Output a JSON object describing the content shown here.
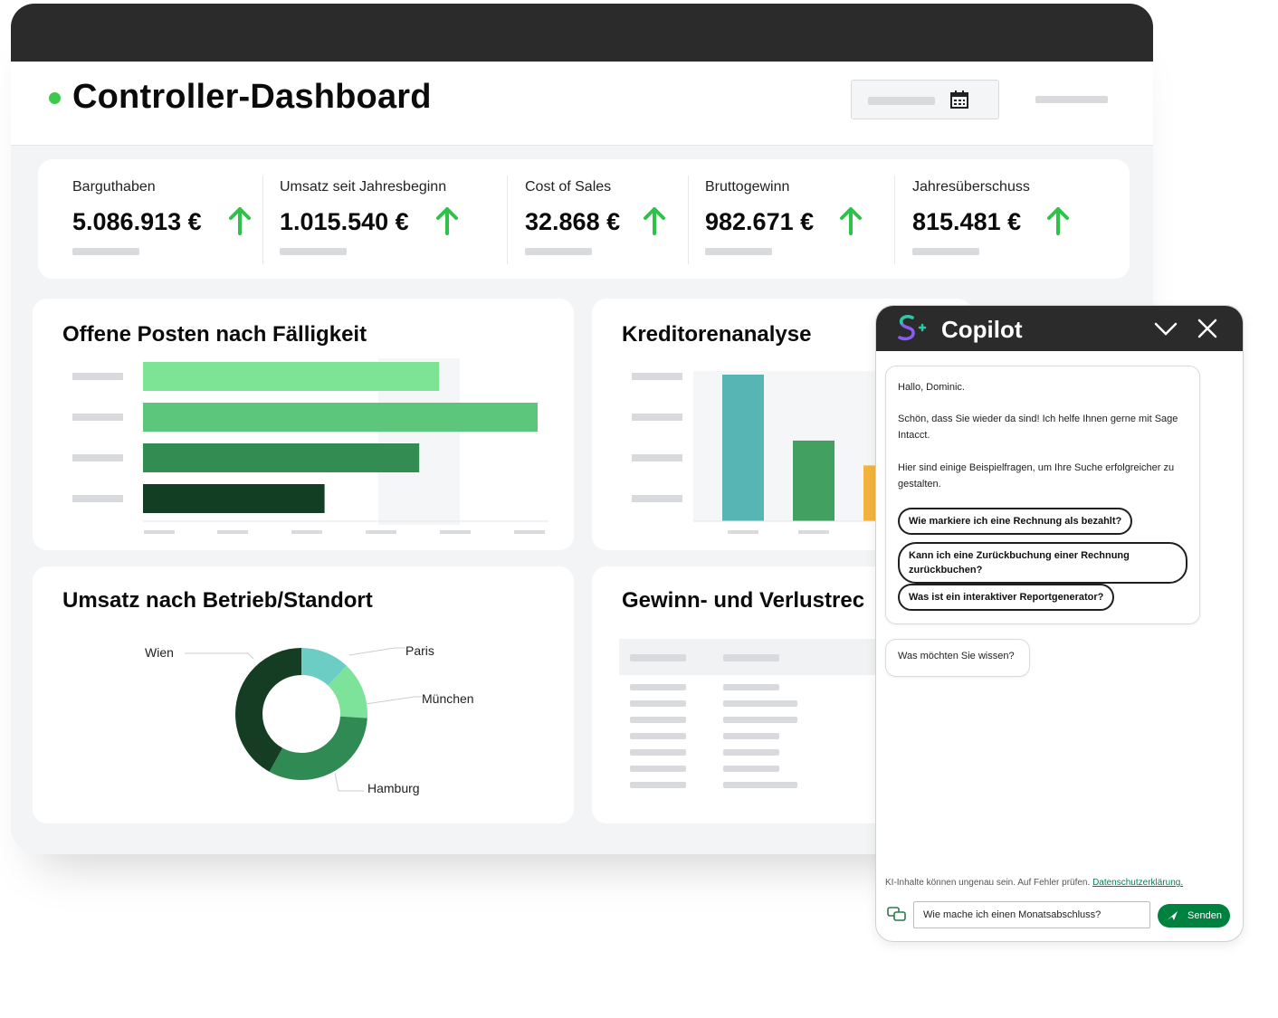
{
  "dashboard": {
    "title": "Controller-Dashboard"
  },
  "kpis": [
    {
      "label": "Barguthaben",
      "value": "5.086.913 €",
      "trend": "up"
    },
    {
      "label": "Umsatz seit Jahresbeginn",
      "value": "1.015.540 €",
      "trend": "up"
    },
    {
      "label": "Cost of Sales",
      "value": "32.868 €",
      "trend": "up"
    },
    {
      "label": "Bruttogewinn",
      "value": "982.671 €",
      "trend": "up"
    },
    {
      "label": "Jahresüberschuss",
      "value": "815.481 €",
      "trend": "up"
    }
  ],
  "panels": {
    "open_items": {
      "title": "Offene Posten nach Fälligkeit"
    },
    "creditors": {
      "title": "Kreditorenanalyse"
    },
    "revenue": {
      "title": "Umsatz nach Betrieb/Standort"
    },
    "pnl": {
      "title": "Gewinn- und Verlustrec"
    }
  },
  "chart_data": [
    {
      "type": "bar",
      "orientation": "horizontal",
      "title": "Offene Posten nach Fälligkeit",
      "values": [
        0.75,
        1.0,
        0.7,
        0.46
      ],
      "colors": [
        "#7de495",
        "#5cc77b",
        "#338c51",
        "#123f24"
      ]
    },
    {
      "type": "bar",
      "title": "Kreditorenanalyse",
      "values": [
        1.0,
        0.55,
        0.38
      ],
      "colors": [
        "#57b5b3",
        "#42a061",
        "#f2b43c"
      ]
    },
    {
      "type": "pie",
      "title": "Umsatz nach Betrieb/Standort",
      "categories": [
        "Paris",
        "München",
        "Hamburg",
        "Wien"
      ],
      "values": [
        12,
        14,
        32,
        42
      ],
      "colors": [
        "#6ccdc4",
        "#7ee39a",
        "#2f8a53",
        "#153d24"
      ]
    }
  ],
  "copilot": {
    "title": "Copilot",
    "greeting": "Hallo, Dominic.",
    "welcome": "Schön, dass Sie wieder da sind! Ich helfe Ihnen gerne mit Sage Intacct.",
    "intro": "Hier sind einige Beispielfragen, um Ihre Suche erfolgreicher zu gestalten.",
    "suggestions": [
      "Wie markiere ich eine Rechnung als bezahlt?",
      "Kann ich eine Zurückbuchung einer Rechnung zurückbuchen?",
      "Was ist ein interaktiver Reportgenerator?"
    ],
    "ask": "Was möchten Sie wissen?",
    "disclaimer": "KI-Inhalte können ungenau sein. Auf Fehler prüfen.",
    "privacy_link": "Datenschutzerklärung.",
    "input_value": "Wie mache ich einen Monatsabschluss?",
    "send_label": "Senden"
  },
  "colors": {
    "brand_green": "#00813f",
    "trend_up": "#2ec24a",
    "dark_bar": "#2b2b2b"
  },
  "icons": [
    "calendar-icon",
    "arrow-up-icon",
    "sage-copilot-logo-icon",
    "chevron-down-icon",
    "close-icon",
    "chat-bubbles-icon",
    "send-icon"
  ]
}
